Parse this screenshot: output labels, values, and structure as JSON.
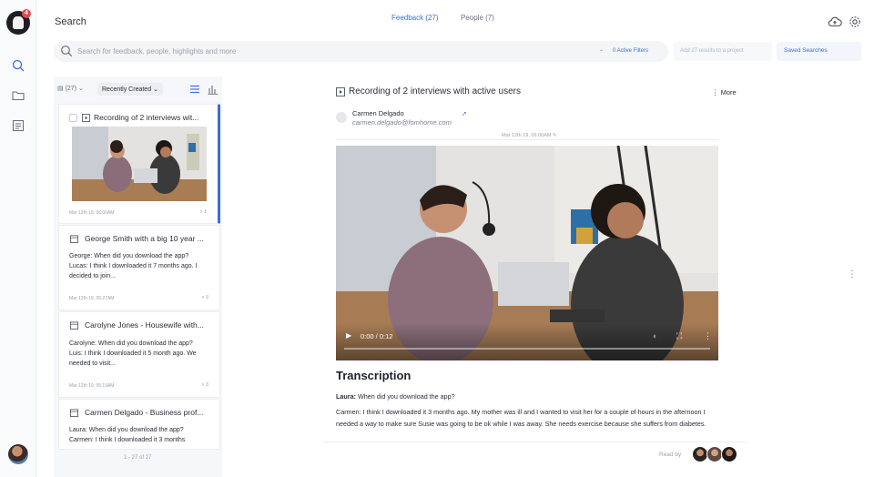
{
  "nav": {
    "notification_count": "4",
    "items": [
      "search",
      "folder",
      "notes"
    ]
  },
  "header": {
    "title": "Search",
    "tabs": [
      {
        "label": "Feedback (27)",
        "active": true
      },
      {
        "label": "People (7)",
        "active": false
      }
    ]
  },
  "search": {
    "placeholder": "Search for feedback, people, highlights and more",
    "active_filters": "0 Active Filters",
    "add_to_project": "Add 27 results to a project",
    "saved_searches": "Saved Searches"
  },
  "list": {
    "count": "(27)",
    "sort": "Recently Created",
    "pagination": "1 - 27 of 27",
    "items": [
      {
        "title": "Recording of 2 interviews wit...",
        "type": "video",
        "date": "Mar 12th 19, 06:00AM",
        "count": "1",
        "excerpt": ""
      },
      {
        "title": "George Smith with a big 10 year ...",
        "type": "note",
        "date": "Mar 12th 19, 05:27AM",
        "count": "9",
        "excerpt": "George: When did you download the app?\nLucas: I think I downloaded it 7 months ago. I decided to join..."
      },
      {
        "title": "Carolyne Jones - Housewife with...",
        "type": "note",
        "date": "Mar 12th 19, 05:19AM",
        "count": "3",
        "excerpt": "Carolyne: When did you download the app?\nLuis: I think I downloaded it 5 month ago. We needed to visit..."
      },
      {
        "title": "Carmen Delgado - Business prof...",
        "type": "note",
        "date": "",
        "count": "",
        "excerpt": "Laura: When did you download the app?\nCarmen: I think I downloaded it 3 months"
      }
    ]
  },
  "detail": {
    "title": "Recording of 2 interviews with active users",
    "more": "More",
    "author_name": "Carmen Delgado",
    "author_email": "carmen.delgado@fomhome.com",
    "date": "Mar 12th 19, 06:00AM",
    "video_time": "0:00 / 0:12",
    "transcription_heading": "Transcription",
    "transcript": [
      {
        "speaker": "Laura:",
        "text": "When did you download the app?"
      },
      {
        "speaker": "Carmen:",
        "text": "I think I downloaded it 3 months ago. My mother was ill and I wanted to visit her for a couple of hours in the afternoon I needed a way to make sure Susie was going to be ok while I was away. She needs exercise because she suffers from diabetes."
      }
    ],
    "read_by": "Read by"
  },
  "colors": {
    "accent": "#3b6fd8",
    "text": "#2b2f3a",
    "muted": "#9ba1ad",
    "panel": "#f6f7f9"
  }
}
